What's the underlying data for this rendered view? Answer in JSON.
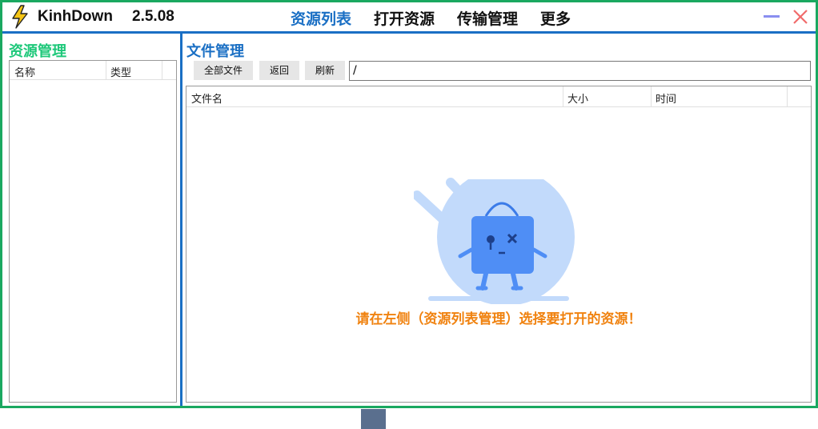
{
  "app": {
    "name": "KinhDown",
    "version": "2.5.08"
  },
  "menu": {
    "items": [
      {
        "label": "资源列表",
        "active": true
      },
      {
        "label": "打开资源",
        "active": false
      },
      {
        "label": "传输管理",
        "active": false
      },
      {
        "label": "更多",
        "active": false
      }
    ]
  },
  "window_controls": {
    "minimize_icon": "minimize-icon",
    "close_icon": "close-icon"
  },
  "left_panel": {
    "title": "资源管理",
    "columns": [
      "名称",
      "类型"
    ]
  },
  "right_panel": {
    "title": "文件管理",
    "toolbar": {
      "all_files": "全部文件",
      "back": "返回",
      "refresh": "刷新"
    },
    "path_value": "/",
    "columns": [
      "文件名",
      "大小",
      "时间"
    ],
    "empty_message": "请在左侧（资源列表管理）选择要打开的资源！"
  },
  "colors": {
    "frame": "#1aa860",
    "accent_blue": "#1a6fc4",
    "accent_green": "#1ec87a",
    "warning_orange": "#f0820f",
    "close_red": "#f06b6b",
    "minimize_purple": "#8a8ff0"
  }
}
